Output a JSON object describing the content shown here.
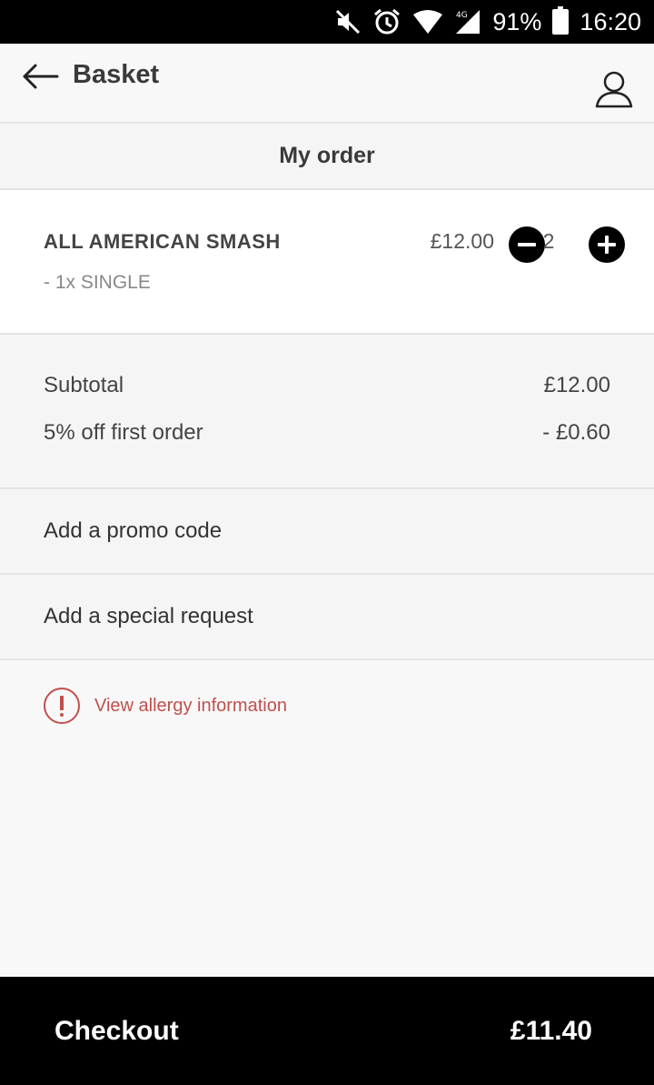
{
  "status_bar": {
    "battery": "91%",
    "time": "16:20",
    "network": "4G"
  },
  "header": {
    "title": "Basket",
    "back_icon": "arrow-left-icon",
    "account_icon": "user-icon"
  },
  "section": {
    "title": "My order"
  },
  "order": {
    "items": [
      {
        "name": "ALL AMERICAN SMASH",
        "modifier": "- 1x SINGLE",
        "price": "£12.00",
        "quantity": "2"
      }
    ]
  },
  "totals": {
    "subtotal_label": "Subtotal",
    "subtotal_value": "£12.00",
    "discount_label": "5% off first order",
    "discount_value": "- £0.60"
  },
  "actions": {
    "promo": "Add a promo code",
    "special_request": "Add a special request",
    "allergy": "View allergy information"
  },
  "checkout": {
    "label": "Checkout",
    "total": "£11.40"
  },
  "colors": {
    "accent_red": "#c0504d",
    "bar_black": "#000000",
    "background": "#f8f8f8"
  }
}
